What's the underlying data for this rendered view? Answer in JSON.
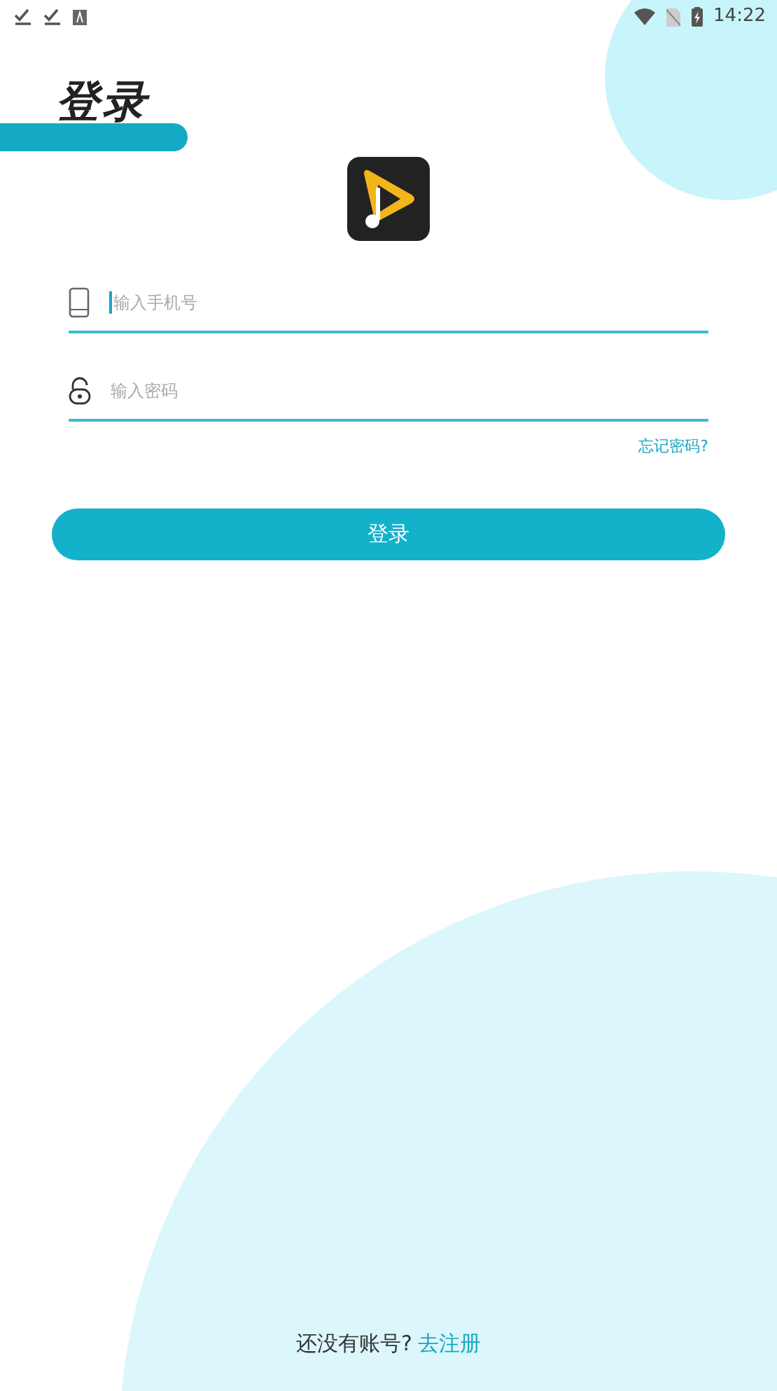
{
  "status_bar": {
    "time": "14:22"
  },
  "title": "登录",
  "fields": [
    {
      "kind": "phone",
      "placeholder": "输入手机号",
      "focused": true
    },
    {
      "kind": "password",
      "placeholder": "输入密码",
      "focused": false
    }
  ],
  "forgot_link": "忘记密码?",
  "login_button": "登录",
  "footer": {
    "text": "还没有账号?",
    "link": "去注册"
  }
}
